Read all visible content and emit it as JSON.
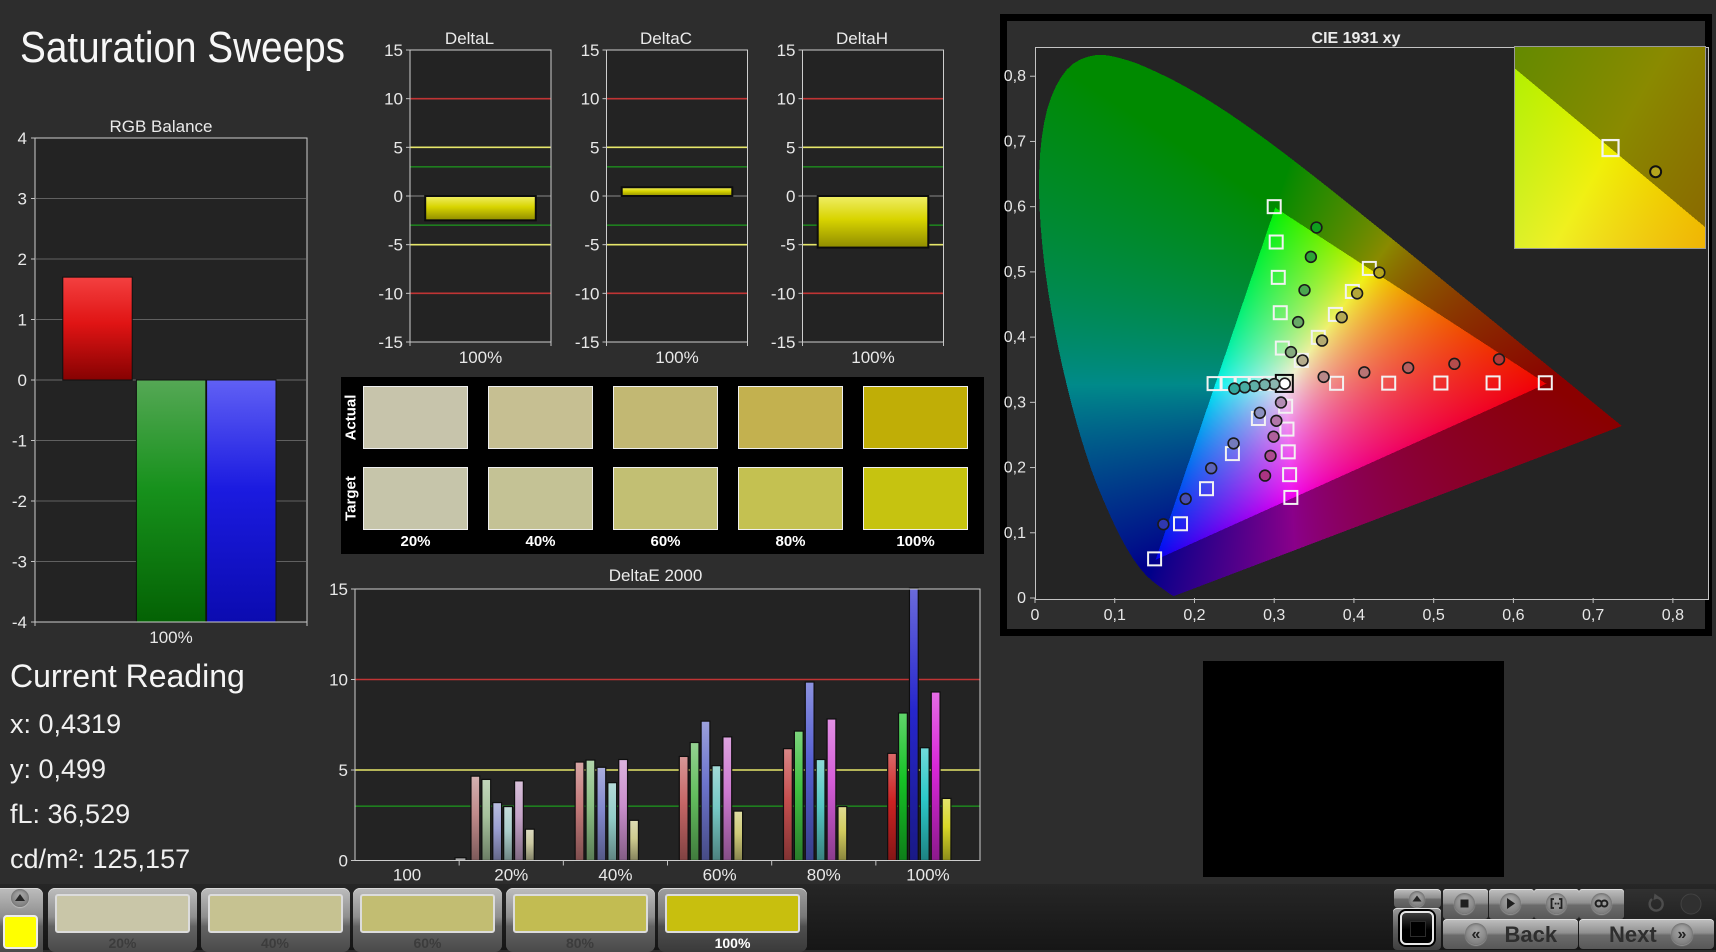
{
  "page": {
    "title": "Saturation Sweeps",
    "background": "#2d2d2d"
  },
  "rgb_balance": {
    "type": "bar",
    "title": "RGB Balance",
    "x_label": "100%",
    "ylim": [
      -4,
      4
    ],
    "yticks": [
      "4",
      "3",
      "2",
      "1",
      "0",
      "-1",
      "-2",
      "-3",
      "-4"
    ],
    "series": [
      {
        "name": "red",
        "value": 1.7,
        "color": "#e01414",
        "color_top": "#f34040",
        "color_bottom": "#860202"
      },
      {
        "name": "green",
        "value": -4.0,
        "color": "#17911c",
        "color_top": "#55a855",
        "color_bottom": "#046204"
      },
      {
        "name": "blue",
        "value": -4.0,
        "color": "#1b1be0",
        "color_top": "#6060f5",
        "color_bottom": "#0b0bb0"
      }
    ]
  },
  "delta_charts": {
    "type": "bar",
    "ylim": [
      -15,
      15
    ],
    "yticks": [
      "15",
      "10",
      "5",
      "0",
      "-5",
      "-10",
      "-15"
    ],
    "x_label": "100%",
    "limit_lines": [
      {
        "value": 10,
        "color": "#c03434"
      },
      {
        "value": 5,
        "color": "#e6e66a"
      },
      {
        "value": 3,
        "color": "#1e7e1e"
      },
      {
        "value": -3,
        "color": "#1e7e1e"
      },
      {
        "value": -5,
        "color": "#e6e66a"
      },
      {
        "value": -10,
        "color": "#c03434"
      }
    ],
    "bar_color": "#d8d400",
    "bar_color_top": "#f0ee66",
    "bar_color_bottom": "#8f8c00",
    "charts": [
      {
        "title": "DeltaL",
        "value": -2.5
      },
      {
        "title": "DeltaC",
        "value": 0.9
      },
      {
        "title": "DeltaH",
        "value": -5.3
      }
    ]
  },
  "saturation_swatches": {
    "row_labels": [
      "Actual",
      "Target"
    ],
    "levels": [
      "20%",
      "40%",
      "60%",
      "80%",
      "100%"
    ],
    "actual_colors": [
      "#c7c4ab",
      "#c6bf92",
      "#c2b873",
      "#c3b14f",
      "#c0ae06"
    ],
    "target_colors": [
      "#c6c5aa",
      "#c4c295",
      "#c2bf73",
      "#c4c151",
      "#c6c310"
    ]
  },
  "deltae_chart": {
    "type": "bar",
    "title": "DeltaE 2000",
    "ylim": [
      0,
      15
    ],
    "yticks": [
      "15",
      "10",
      "5",
      "0"
    ],
    "groups": [
      "100",
      "20%",
      "40%",
      "60%",
      "80%",
      "100%"
    ],
    "limit_lines": [
      {
        "value": 10,
        "color": "#c03434"
      },
      {
        "value": 5,
        "color": "#e6e66a"
      },
      {
        "value": 3,
        "color": "#1e7e1e"
      }
    ],
    "white_bar": {
      "group": "100",
      "value": 0.15,
      "color": "#b8b8b8"
    },
    "series": [
      {
        "name": "red",
        "values": [
          4.66,
          5.44,
          5.75,
          6.18,
          5.92
        ],
        "colors": [
          "#c08b8b",
          "#c47a7a",
          "#c56666",
          "#c64f4f",
          "#cc2222"
        ]
      },
      {
        "name": "green",
        "values": [
          4.48,
          5.55,
          6.52,
          7.15,
          8.15
        ],
        "colors": [
          "#a6c29c",
          "#8cc084",
          "#63bd5e",
          "#3fc040",
          "#16c226"
        ]
      },
      {
        "name": "blue",
        "values": [
          3.2,
          5.15,
          7.7,
          9.86,
          15.5
        ],
        "colors": [
          "#9a9ed2",
          "#8389cf",
          "#6c74cc",
          "#565fd2",
          "#2626cc"
        ]
      },
      {
        "name": "cyan",
        "values": [
          2.98,
          4.3,
          5.24,
          5.58,
          6.23
        ],
        "colors": [
          "#abcecb",
          "#93ccc8",
          "#76c8c4",
          "#57c8c4",
          "#2cc8c8"
        ]
      },
      {
        "name": "magenta",
        "values": [
          4.4,
          5.58,
          6.83,
          7.82,
          9.31
        ],
        "colors": [
          "#c5a3c8",
          "#ca8fcd",
          "#cd78d0",
          "#d55cd8",
          "#d827d8"
        ]
      },
      {
        "name": "yellow",
        "values": [
          1.73,
          2.22,
          2.73,
          2.98,
          3.43
        ],
        "colors": [
          "#cbc9a2",
          "#cdca8f",
          "#cfcb78",
          "#d2cc5e",
          "#d8d828"
        ]
      }
    ]
  },
  "cie_chart": {
    "type": "scatter",
    "title": "CIE 1931 xy",
    "xlim": [
      0,
      0.8428
    ],
    "ylim": [
      0,
      0.8448
    ],
    "xticks": [
      "0",
      "0,1",
      "0,2",
      "0,3",
      "0,4",
      "0,5",
      "0,6",
      "0,7",
      "0,8"
    ],
    "yticks": [
      "0",
      "0,1",
      "0,2",
      "0,3",
      "0,4",
      "0,5",
      "0,6",
      "0,7",
      "0,8"
    ],
    "tick_step": 0.1,
    "white_point": [
      0.3127,
      0.329
    ],
    "gamut_triangle": {
      "red": [
        0.64,
        0.33
      ],
      "green": [
        0.3,
        0.6
      ],
      "blue": [
        0.15,
        0.06
      ]
    },
    "targets": {
      "red": [
        [
          0.3782,
          0.3292
        ],
        [
          0.4436,
          0.3294
        ],
        [
          0.5091,
          0.3296
        ],
        [
          0.5745,
          0.3298
        ],
        [
          0.64,
          0.33
        ]
      ],
      "green": [
        [
          0.3102,
          0.3832
        ],
        [
          0.3076,
          0.4374
        ],
        [
          0.3051,
          0.4916
        ],
        [
          0.3025,
          0.5458
        ],
        [
          0.3,
          0.6
        ]
      ],
      "blue": [
        [
          0.2802,
          0.2752
        ],
        [
          0.2476,
          0.2214
        ],
        [
          0.2151,
          0.1676
        ],
        [
          0.1825,
          0.1138
        ],
        [
          0.15,
          0.06
        ]
      ],
      "cyan": [
        [
          0.2951,
          0.329
        ],
        [
          0.2775,
          0.3289
        ],
        [
          0.2599,
          0.3289
        ],
        [
          0.2422,
          0.3288
        ],
        [
          0.2246,
          0.3287
        ]
      ],
      "magenta": [
        [
          0.3143,
          0.294
        ],
        [
          0.316,
          0.259
        ],
        [
          0.3176,
          0.2241
        ],
        [
          0.3193,
          0.1891
        ],
        [
          0.3209,
          0.1542
        ]
      ],
      "yellow": [
        [
          0.334,
          0.3643
        ],
        [
          0.3553,
          0.3996
        ],
        [
          0.3767,
          0.4348
        ],
        [
          0.398,
          0.47
        ],
        [
          0.4193,
          0.5053
        ]
      ]
    },
    "measurements": {
      "white": {
        "points": [
          [
            0.3133,
            0.3287
          ]
        ],
        "colors": [
          "#ffffff"
        ]
      },
      "red": {
        "points": [
          [
            0.362,
            0.339
          ],
          [
            0.413,
            0.346
          ],
          [
            0.468,
            0.353
          ],
          [
            0.526,
            0.359
          ],
          [
            0.582,
            0.366
          ]
        ],
        "colors": [
          "#b98888",
          "#b87474",
          "#b66060",
          "#b44c4c",
          "#b33a3a"
        ]
      },
      "green": {
        "points": [
          [
            0.321,
            0.377
          ],
          [
            0.33,
            0.423
          ],
          [
            0.338,
            0.472
          ],
          [
            0.346,
            0.523
          ],
          [
            0.353,
            0.568
          ]
        ],
        "colors": [
          "#85ab7f",
          "#68a966",
          "#4aa74e",
          "#2da436",
          "#0fa01e"
        ]
      },
      "blue": {
        "points": [
          [
            0.282,
            0.284
          ],
          [
            0.249,
            0.237
          ],
          [
            0.221,
            0.199
          ],
          [
            0.189,
            0.152
          ],
          [
            0.161,
            0.113
          ]
        ],
        "colors": [
          "#8a90c0",
          "#747abc",
          "#5d64b8",
          "#474eb4",
          "#3038b0"
        ]
      },
      "cyan": {
        "points": [
          [
            0.3,
            0.328
          ],
          [
            0.288,
            0.327
          ],
          [
            0.275,
            0.325
          ],
          [
            0.263,
            0.323
          ],
          [
            0.25,
            0.321
          ]
        ],
        "colors": [
          "#8ab6b0",
          "#74b2ab",
          "#5fafa7",
          "#48aba2",
          "#33a79d"
        ]
      },
      "magenta": {
        "points": [
          [
            0.3085,
            0.2998
          ],
          [
            0.3027,
            0.2717
          ],
          [
            0.2992,
            0.2474
          ],
          [
            0.2954,
            0.218
          ],
          [
            0.2885,
            0.1877
          ]
        ],
        "colors": [
          "#b48cb5",
          "#b276a9",
          "#af609c",
          "#ad4a90",
          "#aa3483"
        ]
      },
      "yellow": {
        "points": [
          [
            0.3356,
            0.3643
          ],
          [
            0.36,
            0.3947
          ],
          [
            0.3847,
            0.4305
          ],
          [
            0.404,
            0.467
          ],
          [
            0.4319,
            0.499
          ]
        ],
        "colors": [
          "#b4ac8c",
          "#b3aa70",
          "#b3a955",
          "#b4a739",
          "#b5a51d"
        ]
      }
    },
    "inset": {
      "x_range": [
        0.3926,
        0.4457
      ],
      "y_range": [
        0.4787,
        0.5322
      ],
      "target": [
        0.4193,
        0.5053
      ],
      "measured": [
        0.4319,
        0.499
      ],
      "measured_color": "#b5a51d"
    }
  },
  "current_reading": {
    "title": "Current Reading",
    "x": "x: 0,4319",
    "y": "y: 0,499",
    "fl": "fL: 36,529",
    "cdm2": "cd/m²: 125,157"
  },
  "toolbar": {
    "current_color": "#ffff00",
    "pattern_buttons": [
      {
        "label": "20%",
        "color": "#c9c6a8",
        "selected": false
      },
      {
        "label": "40%",
        "color": "#c6c291",
        "selected": false
      },
      {
        "label": "60%",
        "color": "#c2bd72",
        "selected": false
      },
      {
        "label": "80%",
        "color": "#c2bc52",
        "selected": false
      },
      {
        "label": "100%",
        "color": "#c8bf0e",
        "selected": true
      }
    ],
    "controls": {
      "advance_icon": "up-triangle",
      "stop_icon": "stop",
      "play_icon": "play",
      "measure_icon": "brackets-dots",
      "continuous_icon": "infinity",
      "refresh_icon": "refresh",
      "back_label": "Back",
      "next_label": "Next"
    }
  }
}
